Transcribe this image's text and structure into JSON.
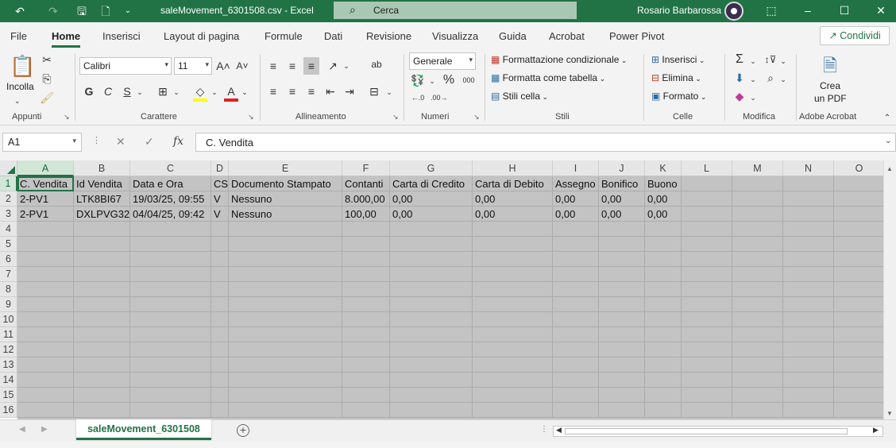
{
  "titlebar": {
    "title": "saleMovement_6301508.csv  -  Excel",
    "search_placeholder": "Cerca",
    "user": "Rosario Barbarossa",
    "undo_icon": "undo-icon",
    "redo_icon": "redo-icon",
    "save_icon": "save-icon"
  },
  "menu": {
    "tabs": [
      "File",
      "Home",
      "Inserisci",
      "Layout di pagina",
      "Formule",
      "Dati",
      "Revisione",
      "Visualizza",
      "Guida",
      "Acrobat",
      "Power Pivot"
    ],
    "active": "Home",
    "share_label": "Condividi"
  },
  "ribbon": {
    "clipboard": {
      "paste_label": "Incolla",
      "group_label": "Appunti"
    },
    "font": {
      "name": "Calibri",
      "size": "11",
      "bold": "G",
      "italic": "C",
      "underline": "S",
      "group_label": "Carattere"
    },
    "alignment": {
      "group_label": "Allineamento"
    },
    "number": {
      "format": "Generale",
      "percent": "%",
      "thousands": "000",
      "group_label": "Numeri"
    },
    "styles": {
      "conditional": "Formattazione condizionale",
      "table": "Formatta come tabella",
      "cell_styles": "Stili cella",
      "group_label": "Stili"
    },
    "cells": {
      "insert": "Inserisci",
      "delete": "Elimina",
      "format": "Formato",
      "group_label": "Celle"
    },
    "editing": {
      "group_label": "Modifica"
    },
    "acrobat": {
      "create_pdf_line1": "Crea",
      "create_pdf_line2": "un PDF",
      "group_label": "Adobe Acrobat"
    }
  },
  "formula_bar": {
    "name_box": "A1",
    "fx": "fx",
    "content": "C. Vendita"
  },
  "grid": {
    "columns": [
      "A",
      "B",
      "C",
      "D",
      "E",
      "F",
      "G",
      "H",
      "I",
      "J",
      "K",
      "L",
      "M",
      "N",
      "O"
    ],
    "row_numbers": [
      "1",
      "2",
      "3",
      "4",
      "5",
      "6",
      "7",
      "8",
      "9",
      "10",
      "11",
      "12",
      "13",
      "14",
      "15",
      "16"
    ],
    "selected_column": "A",
    "selected_row": "1",
    "rows": [
      [
        "C. Vendita",
        "Id Vendita",
        "Data e Ora",
        "CS",
        "Documento Stampato",
        "Contanti",
        "Carta di Credito",
        "Carta di Debito",
        "Assegno",
        "Bonifico",
        "Buono"
      ],
      [
        "2-PV1",
        "LTK8BI67",
        "19/03/25, 09:55",
        "V",
        "Nessuno",
        "8.000,00",
        "0,00",
        "0,00",
        "0,00",
        "0,00",
        "0,00"
      ],
      [
        "2-PV1",
        "DXLPVG32",
        "04/04/25, 09:42",
        "V",
        "Nessuno",
        "100,00",
        "0,00",
        "0,00",
        "0,00",
        "0,00",
        "0,00"
      ]
    ]
  },
  "sheets": {
    "active": "saleMovement_6301508"
  }
}
